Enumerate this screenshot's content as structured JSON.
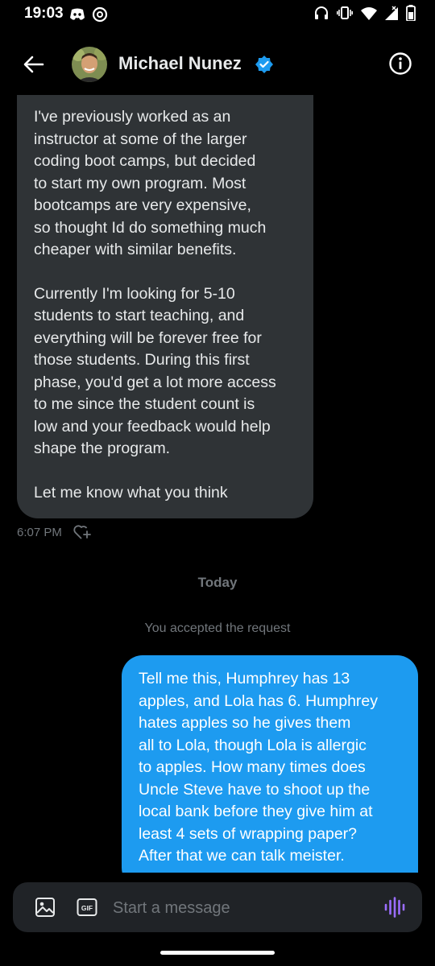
{
  "status_bar": {
    "time": "19:03",
    "icons": [
      "discord-icon",
      "threads-icon",
      "headphones-icon",
      "vibrate-icon",
      "wifi-icon",
      "signal-icon",
      "battery-icon"
    ]
  },
  "header": {
    "contact_name": "Michael Nunez",
    "verified": true,
    "icons": [
      "back-arrow-icon",
      "verified-badge-icon",
      "info-icon"
    ]
  },
  "messages": {
    "incoming": {
      "paragraphs": [
        "I've previously worked as an\ninstructor at some of the larger\ncoding boot camps, but decided\nto start my own program. Most\nbootcamps are very expensive,\nso thought Id do something much\ncheaper with similar benefits.",
        "Currently I'm looking for 5-10\nstudents to start teaching, and\neverything will be forever free for\nthose students. During this first\nphase, you'd get a lot more access\nto me since the student count is\nlow and your feedback would help\nshape the program.",
        "Let me know what you think"
      ],
      "time": "6:07 PM"
    },
    "day_separator": "Today",
    "system_message": "You accepted the request",
    "outgoing": {
      "text": "Tell me this, Humphrey has 13\napples, and Lola has 6. Humphrey\nhates apples so he gives them\nall to Lola, though Lola is allergic\nto apples. How many times does\nUncle Steve have to shoot up the\nlocal bank before they give him at\nleast 4 sets of wrapping paper?\nAfter that we can talk meister."
    }
  },
  "composer": {
    "placeholder": "Start a message",
    "gif_label": "GIF",
    "icons": [
      "image-icon",
      "gif-icon",
      "voice-message-icon"
    ]
  },
  "colors": {
    "background": "#000000",
    "incoming_bubble": "#2f3336",
    "outgoing_bubble": "#1d9bf0",
    "muted_text": "#71767b",
    "accent_voice": "#9b6dff"
  }
}
